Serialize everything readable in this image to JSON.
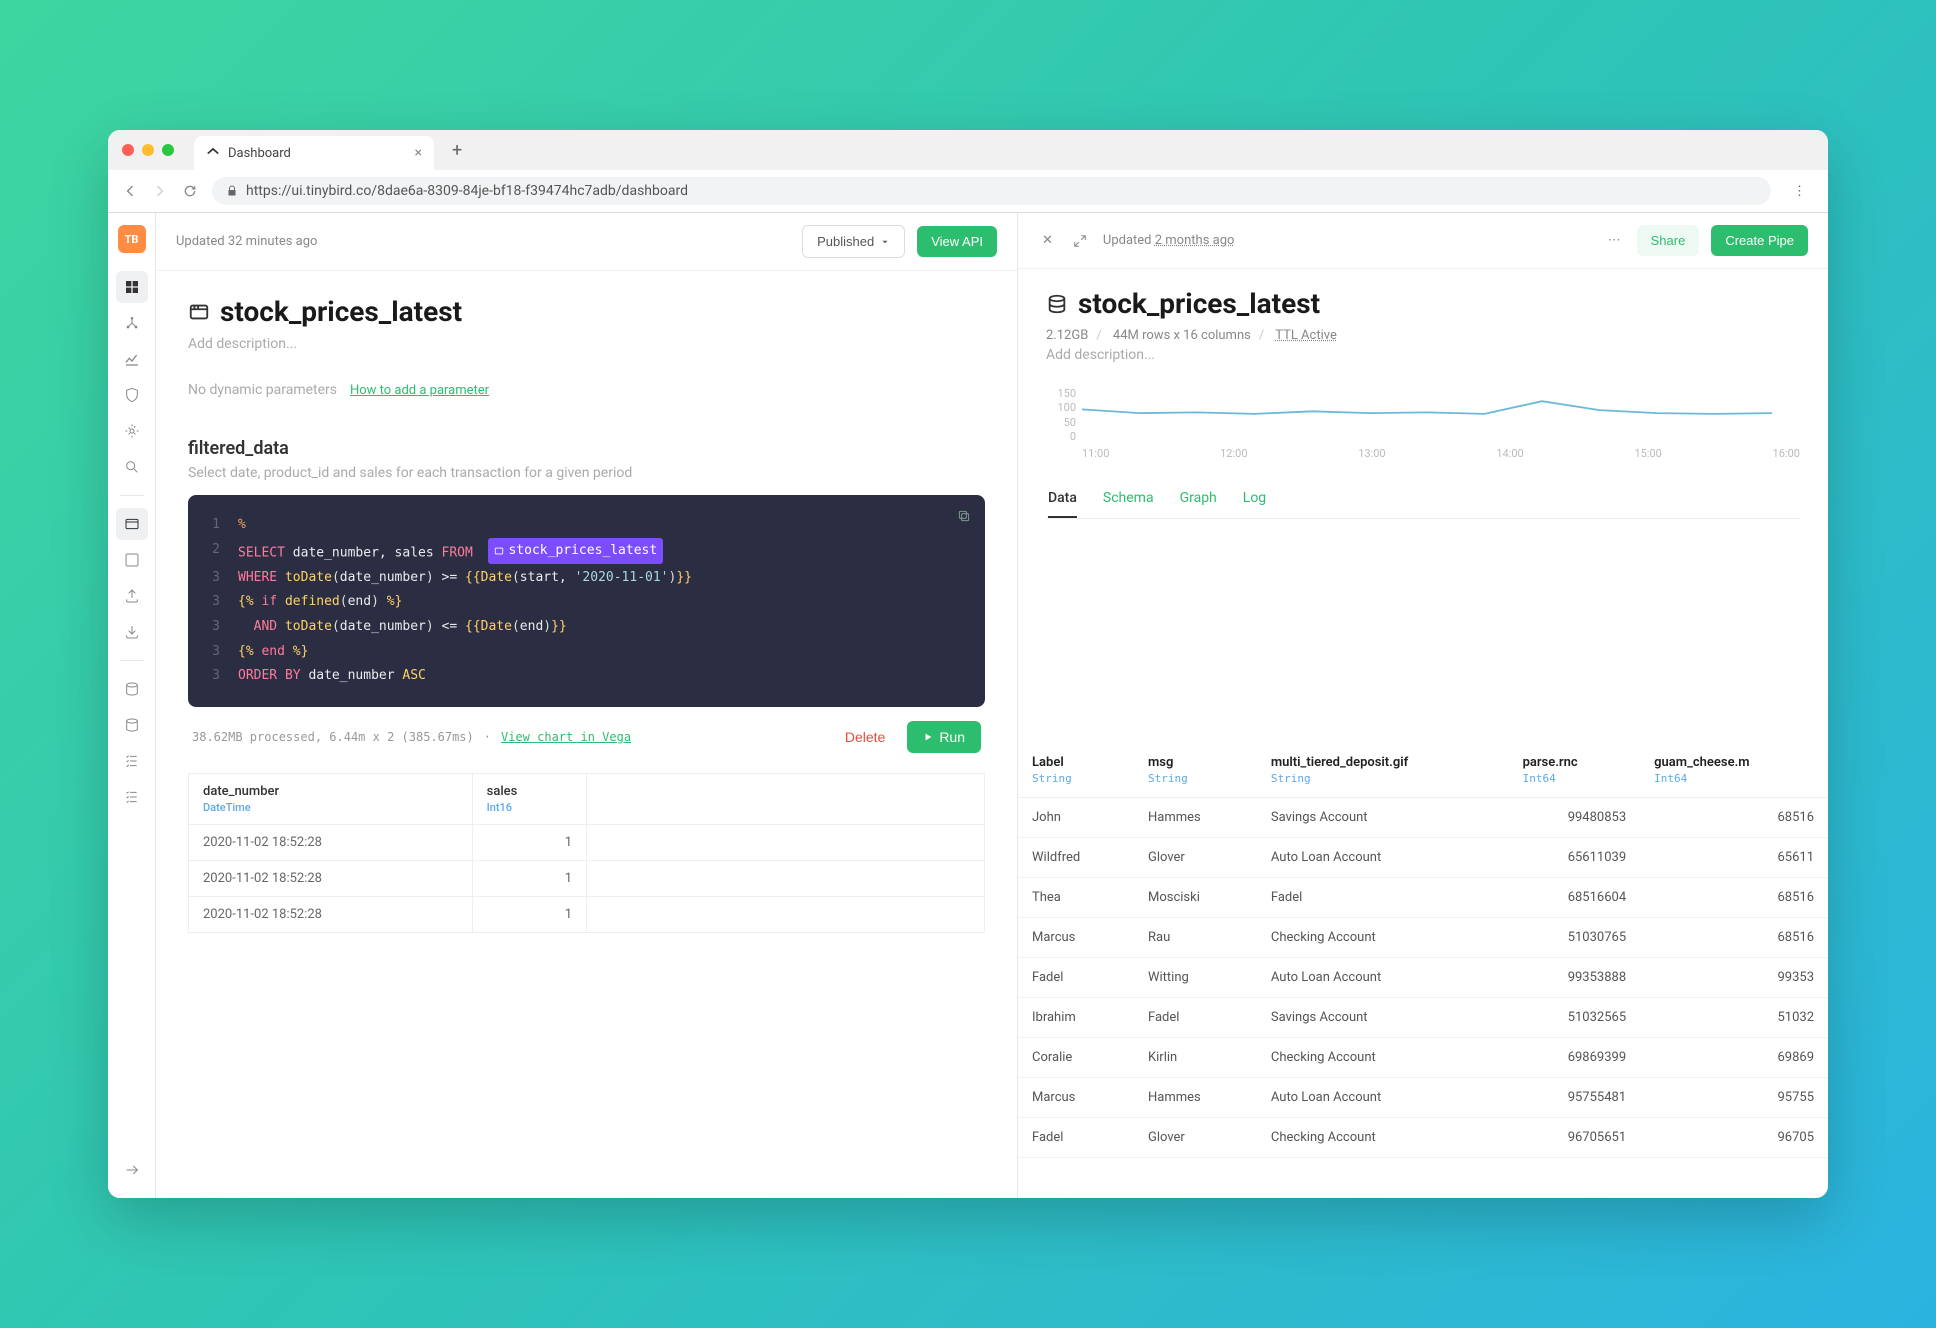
{
  "browser": {
    "tab_title": "Dashboard",
    "url": "https://ui.tinybird.co/8dae6a-8309-84je-bf18-f39474hc7adb/dashboard"
  },
  "sidebar": {
    "logo": "TB"
  },
  "left": {
    "updated": "Updated 32 minutes ago",
    "published_label": "Published",
    "view_api_label": "View API",
    "title": "stock_prices_latest",
    "add_desc": "Add description...",
    "no_params": "No dynamic parameters",
    "how_to": "How to add a parameter",
    "section_name": "filtered_data",
    "section_desc": "Select date, product_id and sales for each transaction for a given period",
    "code": {
      "tag": "stock_prices_latest",
      "lines": [
        "1",
        "2",
        "3",
        "3",
        "3",
        "3",
        "3"
      ]
    },
    "processed": "38.62MB processed, 6.44m x 2 (385.67ms)",
    "view_chart": "View chart in Vega",
    "delete_label": "Delete",
    "run_label": "Run",
    "result_columns": [
      {
        "name": "date_number",
        "type": "DateTime"
      },
      {
        "name": "sales",
        "type": "Int16"
      }
    ],
    "result_rows": [
      {
        "date_number": "2020-11-02 18:52:28",
        "sales": "1"
      },
      {
        "date_number": "2020-11-02 18:52:28",
        "sales": "1"
      },
      {
        "date_number": "2020-11-02 18:52:28",
        "sales": "1"
      }
    ]
  },
  "right": {
    "updated_prefix": "Updated ",
    "updated_link": "2 months ago",
    "share_label": "Share",
    "create_label": "Create Pipe",
    "title": "stock_prices_latest",
    "size": "2.12GB",
    "rows_cols": "44M rows x 16 columns",
    "ttl": "TTL Active",
    "add_desc": "Add description...",
    "tabs": [
      "Data",
      "Schema",
      "Graph",
      "Log"
    ],
    "columns": [
      {
        "name": "Label",
        "type": "String"
      },
      {
        "name": "msg",
        "type": "String"
      },
      {
        "name": "multi_tiered_deposit.gif",
        "type": "String"
      },
      {
        "name": "parse.rnc",
        "type": "Int64"
      },
      {
        "name": "guam_cheese.m",
        "type": "Int64"
      }
    ],
    "rows": [
      {
        "c0": "John",
        "c1": "Hammes",
        "c2": "Savings Account",
        "c3": "99480853",
        "c4": "68516"
      },
      {
        "c0": "Wildfred",
        "c1": "Glover",
        "c2": "Auto Loan Account",
        "c3": "65611039",
        "c4": "65611"
      },
      {
        "c0": "Thea",
        "c1": "Mosciski",
        "c2": "Fadel",
        "c3": "68516604",
        "c4": "68516"
      },
      {
        "c0": "Marcus",
        "c1": "Rau",
        "c2": "Checking Account",
        "c3": "51030765",
        "c4": "68516"
      },
      {
        "c0": "Fadel",
        "c1": "Witting",
        "c2": "Auto Loan Account",
        "c3": "99353888",
        "c4": "99353"
      },
      {
        "c0": "Ibrahim",
        "c1": "Fadel",
        "c2": "Savings Account",
        "c3": "51032565",
        "c4": "51032"
      },
      {
        "c0": "Coralie",
        "c1": "Kirlin",
        "c2": "Checking Account",
        "c3": "69869399",
        "c4": "69869"
      },
      {
        "c0": "Marcus",
        "c1": "Hammes",
        "c2": "Auto Loan Account",
        "c3": "95755481",
        "c4": "95755"
      },
      {
        "c0": "Fadel",
        "c1": "Glover",
        "c2": "Checking Account",
        "c3": "96705651",
        "c4": "96705"
      }
    ]
  },
  "chart_data": {
    "type": "line",
    "title": "",
    "ylabel": "",
    "xlabel": "",
    "ylim": [
      0,
      150
    ],
    "yticks": [
      0,
      50,
      100,
      150
    ],
    "xticks": [
      "11:00",
      "12:00",
      "13:00",
      "14:00",
      "15:00",
      "16:00"
    ],
    "x": [
      "10:30",
      "11:00",
      "11:30",
      "12:00",
      "12:30",
      "13:00",
      "13:30",
      "14:00",
      "14:30",
      "15:00",
      "15:30",
      "16:00",
      "16:30"
    ],
    "values": [
      90,
      80,
      82,
      78,
      85,
      80,
      82,
      78,
      112,
      88,
      80,
      78,
      80
    ]
  }
}
